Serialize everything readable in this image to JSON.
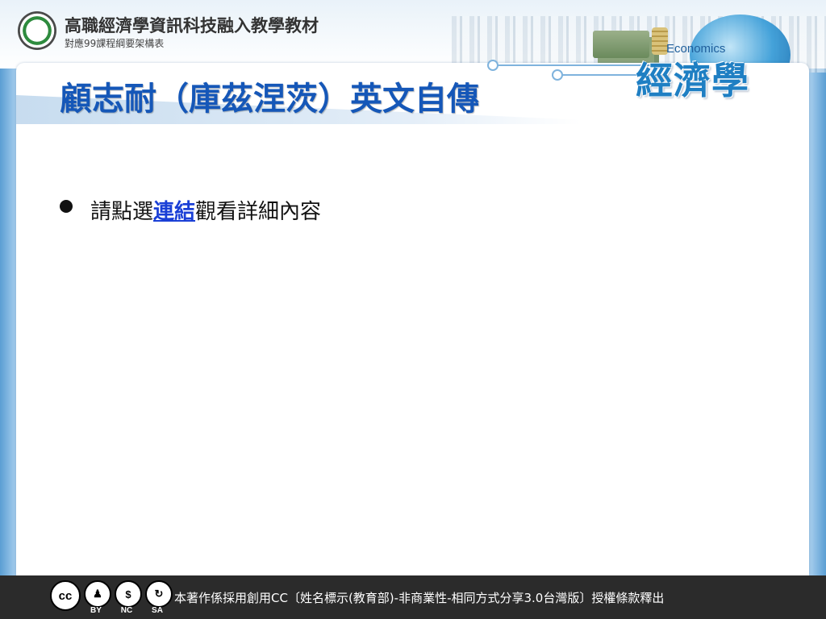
{
  "header": {
    "title": "高職經濟學資訊科技融入教學教材",
    "subtitle": "對應99課程綱要架構表"
  },
  "brand": {
    "english": "Economics",
    "chinese": "經濟學"
  },
  "slide": {
    "title": "顧志耐（庫茲涅茨）英文自傳",
    "bullet_prefix": "請點選",
    "bullet_link": "連結",
    "bullet_suffix": "觀看詳細內容"
  },
  "footer": {
    "license_text": "本著作係採用創用CC〔姓名標示(教育部)-非商業性-相同方式分享3.0台灣版〕授權條款釋出",
    "cc_labels": [
      "BY",
      "NC",
      "SA"
    ],
    "cc_main": "cc"
  },
  "colors": {
    "title": "#1557b8",
    "link": "#1a3fd6",
    "footer_bg": "#2b2b2b"
  }
}
